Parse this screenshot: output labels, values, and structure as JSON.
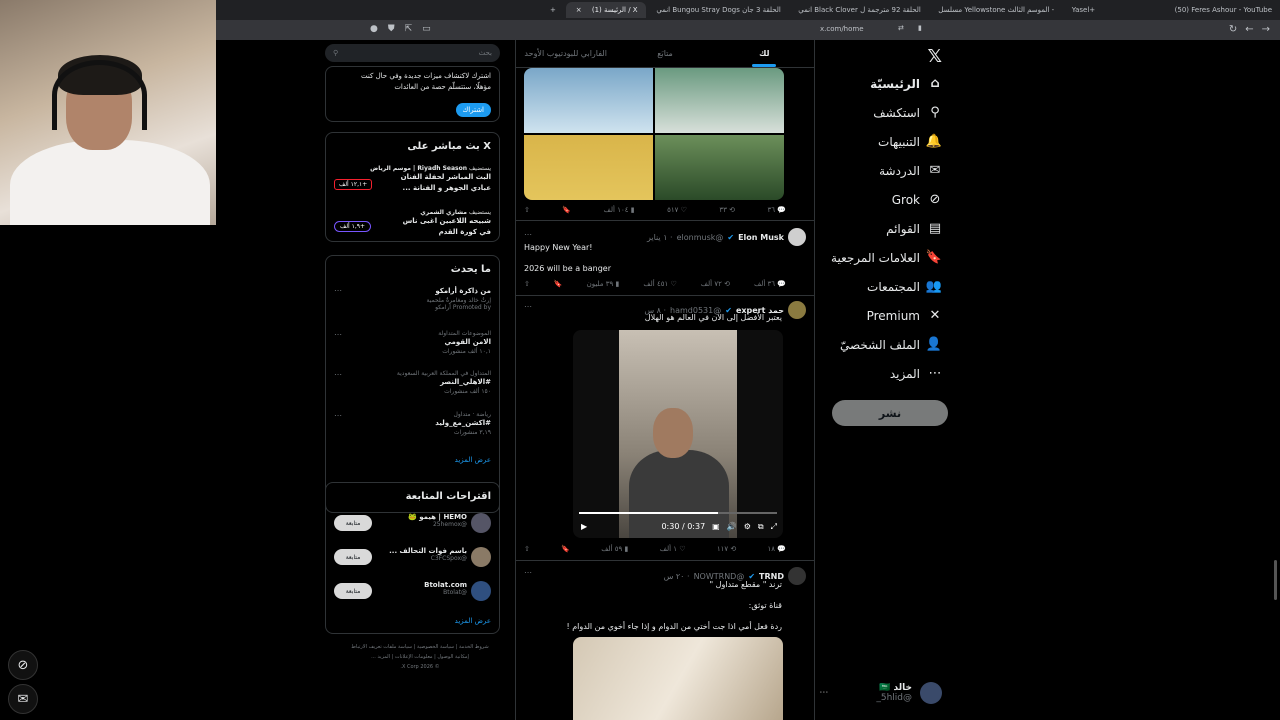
{
  "browser": {
    "tabs": [
      {
        "label": "(50) Feres Ashour - YouTube"
      },
      {
        "label": "Yasel+"
      },
      {
        "label": "مسلسل Yellowstone الموسم الثالث -"
      },
      {
        "label": "انمي Black Clover الحلقة 92 مترجمة ل"
      },
      {
        "label": "انمي Bungou Stray Dogs الحلقة 3 جان"
      },
      {
        "label": "(1) الرئيسة / X"
      }
    ],
    "url": "x.com/home"
  },
  "nav": {
    "items": [
      {
        "label": "الرئيسيّة",
        "icon": "home-icon",
        "glyph": "⌂",
        "bold": true
      },
      {
        "label": "استكشف",
        "icon": "search-icon",
        "glyph": "⚲",
        "bold": false
      },
      {
        "label": "التنبيهات",
        "icon": "bell-icon",
        "glyph": "🔔",
        "bold": false
      },
      {
        "label": "الدردشة",
        "icon": "mail-icon",
        "glyph": "✉",
        "bold": false
      },
      {
        "label": "Grok",
        "icon": "grok-icon",
        "glyph": "⊘",
        "bold": false
      },
      {
        "label": "القوائم",
        "icon": "list-icon",
        "glyph": "▤",
        "bold": false
      },
      {
        "label": "العلامات المرجعية",
        "icon": "bookmark-icon",
        "glyph": "🔖",
        "bold": false
      },
      {
        "label": "المجتمعات",
        "icon": "communities-icon",
        "glyph": "👥",
        "bold": false
      },
      {
        "label": "Premium",
        "icon": "x-premium-icon",
        "glyph": "✕",
        "bold": false
      },
      {
        "label": "الملف الشخصيّ",
        "icon": "profile-icon",
        "glyph": "👤",
        "bold": false
      },
      {
        "label": "المزيد",
        "icon": "more-icon",
        "glyph": "⋯",
        "bold": false
      }
    ],
    "post_label": "نشر",
    "profile": {
      "name": "خالد 🇸🇦",
      "handle": "@5hlid_"
    }
  },
  "timeline": {
    "tabs": [
      "لك",
      "متابَع",
      "الفارابي للبودتيوب الأوحد"
    ],
    "post1_stats": {
      "replies": "٣٦",
      "reposts": "٣٣",
      "likes": "٥١٧",
      "views": "١٠٤ ألف"
    },
    "tweet2": {
      "name": "Elon Musk",
      "handle": "@elonmusk",
      "time": "· ١ يناير",
      "line1": "Happy New Year!",
      "line2": "2026 will be a banger",
      "replies": "٣٦ ألف",
      "reposts": "٧٢ ألف",
      "likes": "٤٥١ ألف",
      "views": "٣٩ مليون"
    },
    "tweet3": {
      "name": "حمد expert",
      "handle": "@hamd0531",
      "time": "· ٨ س",
      "text": "يعتبر الأفضل إلى الان في العالم هو الهلال",
      "video_time": "0:30 / 0:37",
      "replies": "١٨",
      "reposts": "١١٧",
      "likes": "١ ألف",
      "views": "٥٩ ألف"
    },
    "tweet4": {
      "name": "TRND",
      "handle": "@NOWTRND",
      "time": "· ٢٠ س",
      "line1": "ترند \" مقطع متداول \"",
      "line2": "قناة توثق:",
      "line3": "ردة فعل أمي اذا جت أختي من الدوام و إذا جاء أخوي من الدوام !"
    }
  },
  "sidebar": {
    "search_placeholder": "بحث",
    "premium": {
      "text": "اشترك لاكتشاف ميزات جديدة وفي حال كنت مؤهلًا، ستتسلّم حصة من العائدات",
      "button": "اشتراك"
    },
    "live": {
      "title": "X بث مباشر على",
      "item1": {
        "host": "Riyadh Season | موسم الرياض",
        "host_prefix": "يستضيف",
        "title": "البث المباشر لحفلة الفنان عبادي الجوهر و الفنانة ...",
        "badge": "+١٢,١ ألف"
      },
      "item2": {
        "host": "مشاري الشمري",
        "host_prefix": "يستضيف",
        "title": "شبيحه اللاعبين اغبى ناس في كورة القدم",
        "badge": "+١,٩ ألف"
      }
    },
    "trending": {
      "title": "ما يحدث",
      "promo": {
        "title": "من ذاكرة أرامكو",
        "desc": "إرثٌ خالد ومغامرةٌ ملحمية",
        "promoted": "Promoted by أرامكو"
      },
      "items": [
        {
          "category": "الموضوعات المتداولة",
          "topic": "الامن القومي",
          "count": "١٠,١ ألف منشورات"
        },
        {
          "category": "المتداول في المملكة العربية السعودية",
          "topic": "#الاهلي_النصر",
          "count": "١٥٠ ألف منشورات"
        },
        {
          "category": "رياضة · متداول",
          "topic": "#اكشن_مع_وليد",
          "count": "٣,١٩ منشورات"
        }
      ],
      "show_more": "عرض المزيد"
    },
    "follow": {
      "title": "اقتراحات المتابعة",
      "items": [
        {
          "name": "HEMO | هيمو 🐸",
          "handle": "@25hemox",
          "button": "متابعة"
        },
        {
          "name": "باسم فوات التحالف ...",
          "handle": "@C3FCSpox",
          "button": "متابعة"
        },
        {
          "name": "Btolat.com",
          "handle": "@Btolat",
          "button": "متابعة"
        }
      ],
      "show_more": "عرض المزيد"
    },
    "footer": {
      "line1": "شروط الخدمة | سياسة الخصوصية | سياسة ملفات تعريف الارتباط",
      "line2": "إمكانية الوصول | معلومات الإعلانات | المزيد ...",
      "line3": "© 2026 X Corp."
    }
  }
}
